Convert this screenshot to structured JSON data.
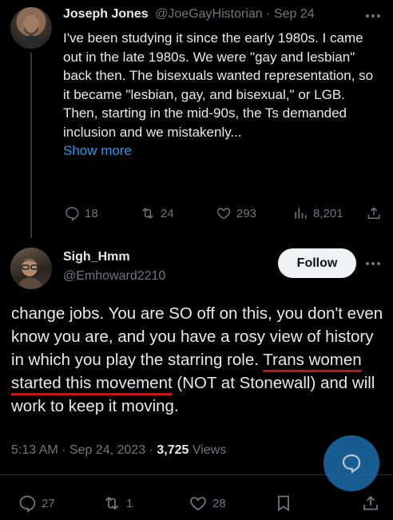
{
  "parent_tweet": {
    "author_name": "Joseph Jones",
    "author_handle": "@JoeGayHistorian",
    "separator": "·",
    "date": "Sep 24",
    "text": "I've been studying it since the early 1980s. I came out in the late 1980s. We were \"gay and lesbian\" back then. The bisexuals wanted representation, so it became \"lesbian, gay, and bisexual,\" or LGB. Then, starting in the mid-90s, the Ts demanded inclusion and we mistakenly...",
    "show_more": "Show more",
    "actions": {
      "replies": "18",
      "reposts": "24",
      "likes": "293",
      "views": "8,201"
    }
  },
  "main_tweet": {
    "author_name": "Sigh_Hmm",
    "author_handle": "@Emhoward2210",
    "follow_label": "Follow",
    "text_before": "change jobs. You are SO off on this, you don't even know you are, and you have a rosy view of history in which you play the starring role. ",
    "text_underlined": "Trans women started this movement",
    "text_after": " (NOT at Stonewall) and will work to keep it moving.",
    "time": "5:13 AM",
    "date": "Sep 24, 2023",
    "views_count": "3,725",
    "views_label": "Views",
    "actions": {
      "replies": "27",
      "reposts": "1",
      "likes": "28"
    }
  },
  "colors": {
    "background": "#000000",
    "text": "#e7e9ea",
    "muted": "#71767b",
    "link": "#1d9bf0",
    "underline": "#c0181a",
    "fab": "#1d6ea8"
  },
  "icons": [
    "more-icon",
    "reply-icon",
    "repost-icon",
    "like-icon",
    "views-icon",
    "share-icon",
    "bookmark-icon",
    "compose-message-icon"
  ]
}
